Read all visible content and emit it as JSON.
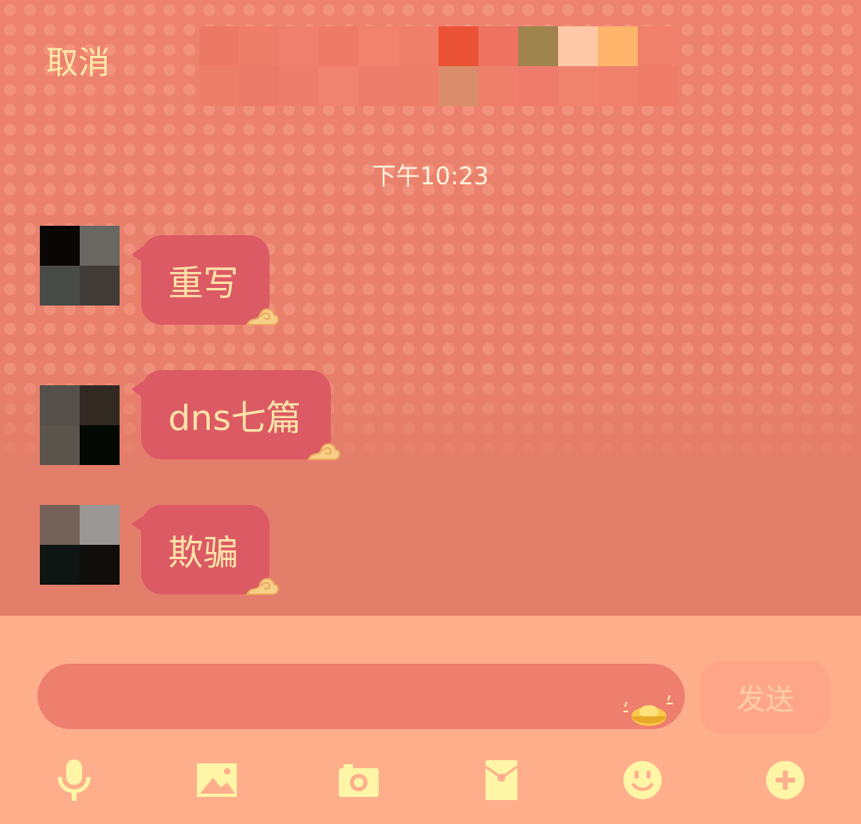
{
  "header": {
    "cancel_label": "取消"
  },
  "chat": {
    "timestamp": "下午10:23",
    "messages": [
      {
        "text": "重写"
      },
      {
        "text": "dns七篇"
      },
      {
        "text": "欺骗"
      }
    ]
  },
  "composer": {
    "input_value": "",
    "send_label": "发送"
  },
  "toolbar": {
    "icons": [
      "microphone-icon",
      "image-icon",
      "camera-icon",
      "red-packet-icon",
      "emoji-icon",
      "plus-icon"
    ]
  },
  "colors": {
    "chat_background": "#e77f6b",
    "bubble": "#db5a64",
    "bubble_text": "#fde3a8",
    "input_area": "#ffae8c",
    "icon": "#fff5a6"
  }
}
